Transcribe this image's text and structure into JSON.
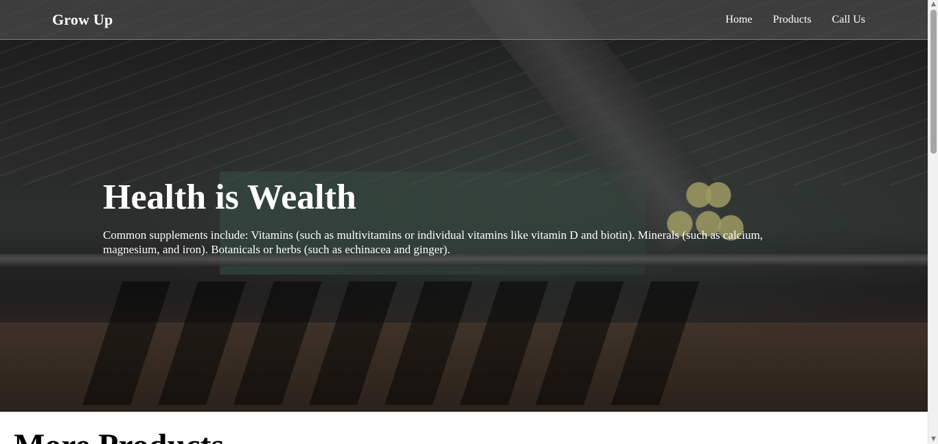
{
  "navbar": {
    "brand": "Grow Up",
    "links": [
      {
        "label": "Home"
      },
      {
        "label": "Products"
      },
      {
        "label": "Call Us"
      }
    ]
  },
  "hero": {
    "title": "Health is Wealth",
    "description": "Common supplements include: Vitamins (such as multivitamins or individual vitamins like vitamin D and biotin). Minerals (such as calcium, magnesium, and iron). Botanicals or herbs (such as echinacea and ginger)."
  },
  "section": {
    "title": "More Products"
  },
  "icons": {
    "scroll_up": "chevron-up-icon",
    "scroll_down": "chevron-down-icon"
  }
}
